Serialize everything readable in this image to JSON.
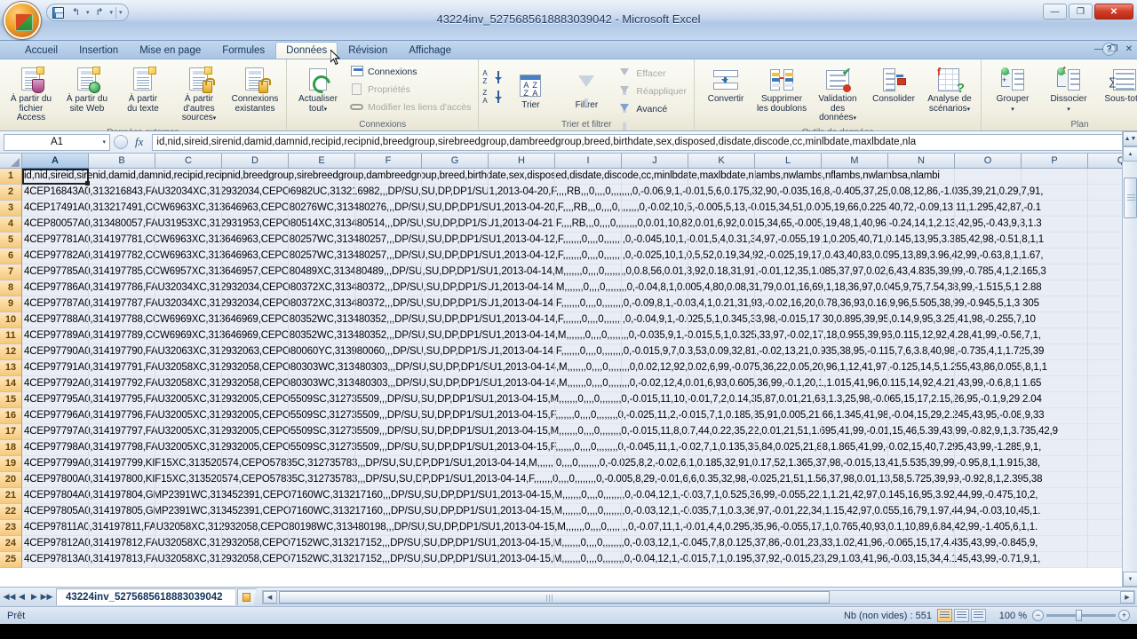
{
  "window": {
    "title": "43224inv_5275685618883039042 - Microsoft Excel",
    "minimize": "—",
    "restore": "❐",
    "close": "✕"
  },
  "quick_access": {
    "save": "save-icon",
    "undo": "↰",
    "redo": "↱",
    "customize": "▾"
  },
  "ribbon": {
    "tabs": [
      {
        "label": "Accueil",
        "active": false
      },
      {
        "label": "Insertion",
        "active": false
      },
      {
        "label": "Mise en page",
        "active": false
      },
      {
        "label": "Formules",
        "active": false
      },
      {
        "label": "Données",
        "active": true
      },
      {
        "label": "Révision",
        "active": false
      },
      {
        "label": "Affichage",
        "active": false
      }
    ],
    "help": "?",
    "groups": [
      {
        "title": "Données externes",
        "buttons": [
          {
            "label_line1": "À partir du",
            "label_line2": "fichier Access"
          },
          {
            "label_line1": "À partir du",
            "label_line2": "site Web"
          },
          {
            "label_line1": "À partir",
            "label_line2": "du texte"
          },
          {
            "label_line1": "À partir d'autres",
            "label_line2": "sources",
            "dropdown": "▾"
          },
          {
            "label_line1": "Connexions",
            "label_line2": "existantes"
          }
        ]
      },
      {
        "title": "Connexions",
        "refresh": {
          "label_line1": "Actualiser",
          "label_line2": "tout",
          "dropdown": "▾"
        },
        "items": [
          {
            "label": "Connexions",
            "disabled": false
          },
          {
            "label": "Propriétés",
            "disabled": true
          },
          {
            "label": "Modifier les liens d'accès",
            "disabled": true
          }
        ]
      },
      {
        "title": "Trier et filtrer",
        "sort_asc": "A→Z",
        "sort_desc": "Z→A",
        "buttons": [
          {
            "label": "Trier"
          },
          {
            "label": "Filtrer"
          }
        ],
        "items": [
          {
            "label": "Effacer",
            "disabled": true
          },
          {
            "label": "Réappliquer",
            "disabled": true
          },
          {
            "label": "Avancé",
            "disabled": false
          }
        ]
      },
      {
        "title": "Outils de données",
        "buttons": [
          {
            "label_line1": "Convertir",
            "label_line2": ""
          },
          {
            "label_line1": "Supprimer",
            "label_line2": "les doublons"
          },
          {
            "label_line1": "Validation des",
            "label_line2": "données",
            "dropdown": "▾"
          },
          {
            "label_line1": "Consolider",
            "label_line2": ""
          },
          {
            "label_line1": "Analyse de",
            "label_line2": "scénarios",
            "dropdown": "▾"
          }
        ]
      },
      {
        "title": "Plan",
        "buttons": [
          {
            "label_line1": "Grouper",
            "label_line2": "",
            "dropdown": "▾"
          },
          {
            "label_line1": "Dissocier",
            "label_line2": "",
            "dropdown": "▾"
          },
          {
            "label_line1": "Sous-total",
            "label_line2": ""
          }
        ],
        "dialog_launcher": "↘"
      }
    ]
  },
  "formula_bar": {
    "name_box": "A1",
    "name_box_dropdown": "▾",
    "fx": "fx",
    "value": "id,nid,sireid,sirenid,damid,damnid,recipid,recipnid,breedgroup,sirebreedgroup,dambreedgroup,breed,birthdate,sex,disposed,disdate,discode,cc,minlbdate,maxlbdate,nla",
    "expand": "▾"
  },
  "grid": {
    "columns": [
      "A",
      "B",
      "C",
      "D",
      "E",
      "F",
      "G",
      "H",
      "I",
      "J",
      "K",
      "L",
      "M",
      "N",
      "O",
      "P",
      "Q"
    ],
    "selected_column": "A",
    "selected_cell": "A1",
    "rows": [
      {
        "num": "1",
        "text": "id,nid,sireid,sirenid,damid,damnid,recipid,recipnid,breedgroup,sirebreedgroup,dambreedgroup,breed,birthdate,sex,disposed,disdate,discode,cc,minlbdate,maxlbdate,nlambs,nwlambs,nflambs,nwlambsa,nlambi"
      },
      {
        "num": "2",
        "text": "4CEP16843A0,313216843,FAU32034XC,312932034,CEPO6982UC,313216982,,,DP/SU,SU,DP,DP1/SU1,2013-04-20,F,,,,RB,,,0,,,,0,,,,,,,,0,-0.06,9,1,-0.01,5,6,0.175,32,90,-0.035,16,8,-0.405,37,25,0.08,12,86,-1.035,39,21,0.29,7,91,"
      },
      {
        "num": "3",
        "text": "4CEP17491A0,313217491,CCW6963XC,313646963,CEPO80276WC,313480276,,,DP/SU,SU,DP,DP1/SU1,2013-04-20,F,,,,RB,,,0,,,,0,,,,,,,,0,-0.02,10,5,-0.005,5,13,-0.015,34,51,0.005,19,66,0.225,40,72,-0.09,13,11,1.295,42,87,-0.1"
      },
      {
        "num": "4",
        "text": "4CEP80057A0,313480057,FAU31953XC,312931953,CEPO80514XC,313480514,,,DP/SU,SU,DP,DP1/SU1,2013-04-21,F,,,,RB,,,0,,,,0,,,,,,,,0,0.01,10,82,0.01,6,92,0.015,34,65,-0.005,19,48,1,40,96,-0.24,14,1,2.13,42,95,-0.43,9,3,1.3"
      },
      {
        "num": "5",
        "text": "4CEP97781A0,314197781,CCW6963XC,313646963,CEPO80257WC,313480257,,,DP/SU,SU,DP,DP1/SU1,2013-04-12,F,,,,,,,0,,,,0,,,,,,,,0,-0.045,10,1,-0.01,5,4,0.31,34,97,-0.055,19,1,0.205,40,71,0.145,13,95,3.385,42,98,-0.51,8,1,1"
      },
      {
        "num": "6",
        "text": "4CEP97782A0,314197782,CCW6963XC,313646963,CEPO80257WC,313480257,,,DP/SU,SU,DP,DP1/SU1,2013-04-12,F,,,,,,,0,,,,0,,,,,,,,0,-0.025,10,1,0,5,52,0.19,34,92,-0.025,19,17,0.43,40,83,0.095,13,89,3.96,42,99,-0.63,8,1,1.67,"
      },
      {
        "num": "7",
        "text": "4CEP97785A0,314197785,CCW6957XC,313646957,CEPO80489XC,313480489,,,DP/SU,SU,DP,DP1/SU1,2013-04-14,M,,,,,,,0,,,,0,,,,,,,,0,0.8,56,0.01,3,92,0.18,31,91,-0.01,12,35,1.085,37,97,0.02,6,43,4.835,39,99,-0.785,4,1,2.165,3"
      },
      {
        "num": "8",
        "text": "4CEP97786A0,314197786,FAU32034XC,312932034,CEPO80372XC,313480372,,,DP/SU,SU,DP,DP1/SU1,2013-04-14,M,,,,,,,0,,,,0,,,,,,,,0,-0.04,8,1,0.005,4,80,0.08,31,79,0.01,16,69,1,18,36,97,0.045,9,75,7.54,38,99,-1.515,5,1,2.88"
      },
      {
        "num": "9",
        "text": "4CEP97787A0,314197787,FAU32034XC,312932034,CEPO80372XC,313480372,,,DP/SU,SU,DP,DP1/SU1,2013-04-14,F,,,,,,,0,,,,0,,,,,,,,0,-0.09,8,1,-0.03,4,1,0.21,31,93,-0.02,16,20,0.78,36,93,0.16,9,96,5.505,38,99,-0.945,5,1,3.305"
      },
      {
        "num": "10",
        "text": "4CEP97788A0,314197788,CCW6969XC,313646969,CEPO80352WC,313480352,,,DP/SU,SU,DP,DP1/SU1,2013-04-14,F,,,,,,,0,,,,0,,,,,,,,0,-0.04,9,1,-0.025,5,1,0.345,33,98,-0.015,17,30,0.895,39,95,0.14,9,95,3.25,41,98,-0.255,7,10"
      },
      {
        "num": "11",
        "text": "4CEP97789A0,314197789,CCW6969XC,313646969,CEPO80352WC,313480352,,,DP/SU,SU,DP,DP1/SU1,2013-04-14,M,,,,,,,0,,,,0,,,,,,,,0,-0.035,9,1,-0.015,5,1,0.325,33,97,-0.02,17,18,0.955,39,96,0.115,12,92,4.28,41,99,-0.56,7,1,"
      },
      {
        "num": "12",
        "text": "4CEP97790A0,314197790,FAU32063XC,312932063,CEPO80060YC,313980060,,,DP/SU,SU,DP,DP1/SU1,2013-04-14,F,,,,,,,0,,,,0,,,,,,,,0,-0.015,9,7,0.3,53,0.09,32,81,-0.02,13,21,0.935,38,95,-0.115,7,6,3.8,40,98,-0.735,4,1,1.725,39"
      },
      {
        "num": "13",
        "text": "4CEP97791A0,314197791,FAU32058XC,312932058,CEPO80303WC,313480303,,,DP/SU,SU,DP,DP1/SU1,2013-04-14,M,,,,,,,0,,,,0,,,,,,,,0,0.02,12,92,0.02,6,99,-0.075,36,22,0.05,20,96,1,12,41,97,-0.125,14,5,1.255,43,86,0.055,8,1,1"
      },
      {
        "num": "14",
        "text": "4CEP97792A0,314197792,FAU32058XC,312932058,CEPO80303WC,313480303,,,DP/SU,SU,DP,DP1/SU1,2013-04-14,M,,,,,,,0,,,,0,,,,,,,,0,-0.02,12,4,0.01,6,93,0.605,36,99,-0.1,20,1,1.015,41,96,0.115,14,92,4.21,43,99,-0.6,8,1,1.65"
      },
      {
        "num": "15",
        "text": "4CEP97795A0,314197795,FAU32005XC,312932005,CEPO5509SC,312735509,,,DP/SU,SU,DP,DP1/SU1,2013-04-15,M,,,,,,,0,,,,0,,,,,,,,0,-0.015,11,10,-0.01,7,2,0.14,35,87,0.01,21,68,1.3,25,98,-0.065,15,17,2.15,26,95,-0.1,9,29,2.04"
      },
      {
        "num": "16",
        "text": "4CEP97796A0,314197796,FAU32005XC,312932005,CEPO5509SC,312735509,,,DP/SU,SU,DP,DP1/SU1,2013-04-15,F,,,,,,,0,,,,0,,,,,,,,0,-0.025,11,2,-0.015,7,1,0.185,35,91,0.005,21,66,1.345,41,98,-0.04,15,29,2.245,43,95,-0.08,9,33"
      },
      {
        "num": "17",
        "text": "4CEP97797A0,314197797,FAU32005XC,312932005,CEPO5509SC,312735509,,,DP/SU,SU,DP,DP1/SU1,2013-04-15,M,,,,,,,0,,,,0,,,,,,,,0,-0.015,11,8,0.7,44,0.22,35,22,0.01,21,51,1.695,41,99,-0.01,15,46,5.39,43,99,-0.82,9,1,3.735,42,9"
      },
      {
        "num": "18",
        "text": "4CEP97798A0,314197798,FAU32005XC,312932005,CEPO5509SC,312735509,,,DP/SU,SU,DP,DP1/SU1,2013-04-15,F,,,,,,,0,,,,0,,,,,,,,0,-0.045,11,1,-0.02,7,1,0.135,35,84,0.025,21,88,1.865,41,99,-0.02,15,40,7.295,43,99,-1.285,9,1,"
      },
      {
        "num": "19",
        "text": "4CEP97799A0,314197799,KIF15XC,313520574,CEPO57835C,312735783,,,DP/SU,SU,DP,DP1/SU1,2013-04-14,M,,,,,,,0,,,,0,,,,,,,,0,-0.025,8,2,-0.02,6,1,0.185,32,91,0.17,52,1.365,37,98,-0.015,13,41,5.535,39,99,-0.95,8,1,1.915,38,"
      },
      {
        "num": "20",
        "text": "4CEP97800A0,314197800,KIF15XC,313520574,CEPO57835C,312735783,,,DP/SU,SU,DP,DP1/SU1,2013-04-14,F,,,,,,,0,,,,0,,,,,,,,0,-0.005,8,29,-0.01,6,6,0.35,32,98,-0.025,21,51,1.56,37,98,0.01,13,58,5.725,39,99,-0.92,8,1,2.395,38"
      },
      {
        "num": "21",
        "text": "4CEP97804A0,314197804,GMP2391WC,313452391,CEPO7160WC,313217160,,,DP/SU,SU,DP,DP1/SU1,2013-04-15,M,,,,,,,0,,,,0,,,,,,,,0,-0.04,12,1,-0.03,7,1,0.525,36,99,-0.055,22,1,1.21,42,97,0.145,16,95,3.92,44,99,-0.475,10,2,"
      },
      {
        "num": "22",
        "text": "4CEP97805A0,314197805,GMP2391WC,313452391,CEPO7160WC,313217160,,,DP/SU,SU,DP,DP1/SU1,2013-04-15,M,,,,,,,0,,,,0,,,,,,,,0,-0.03,12,1,-0.035,7,1,0.3,36,97,-0.01,22,34,1.15,42,97,0.055,16,79,1.97,44,94,-0.03,10,45,1."
      },
      {
        "num": "23",
        "text": "4CEP97811A0,314197811,FAU32058XC,312932058,CEPO80198WC,313480198,,,DP/SU,SU,DP,DP1/SU1,2013-04-15,M,,,,,,,0,,,,0,,,,,,,,0,-0.07,11,1,-0.01,4,4,0.295,35,96,-0.055,17,1,0.765,40,93,0.1,10,89,6.84,42,99,-1.405,6,1,1."
      },
      {
        "num": "24",
        "text": "4CEP97812A0,314197812,FAU32058XC,312932058,CEPO7152WC,313217152,,,DP/SU,SU,DP,DP1/SU1,2013-04-15,M,,,,,,,0,,,,0,,,,,,,,0,-0.03,12,1,-0.045,7,8,0.125,37,86,-0.01,23,33,1.02,41,96,-0.065,15,17,4.435,43,99,-0.845,9,"
      },
      {
        "num": "25",
        "text": "4CEP97813A0,314197813,FAU32058XC,312932058,CEPO7152WC,313217152,,,DP/SU,SU,DP,DP1/SU1,2013-04-15,M,,,,,,,0,,,,0,,,,,,,,0,-0.04,12,1,-0.015,7,1,0.195,37,92,-0.015,23,29,1.03,41,96,-0.03,15,34,4.145,43,99,-0.71,9,1,"
      }
    ]
  },
  "sheet_tabs": {
    "nav_first": "◀◀",
    "nav_prev": "◀",
    "nav_next": "▶",
    "nav_last": "▶▶",
    "tabs": [
      {
        "label": "43224inv_5275685618883039042",
        "active": true
      }
    ],
    "insert_sheet": "insert-worksheet-icon"
  },
  "status_bar": {
    "mode": "Prêt",
    "count_label": "Nb (non vides) : 551",
    "views": [
      "normal-view",
      "page-layout-view",
      "page-break-view"
    ],
    "zoom": "100 %",
    "zoom_out": "−",
    "zoom_in": "+"
  }
}
